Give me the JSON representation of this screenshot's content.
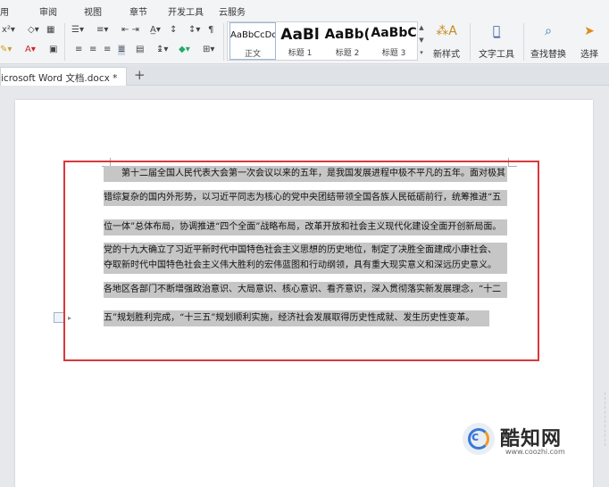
{
  "menu": {
    "items": [
      "用",
      "审阅",
      "视图",
      "章节",
      "开发工具",
      "云服务"
    ]
  },
  "ribbon": {
    "styles": [
      {
        "sample": "AaBbCcDd",
        "caption": "正文"
      },
      {
        "sample": "AaBl",
        "caption": "标题 1"
      },
      {
        "sample": "AaBb(",
        "caption": "标题 2"
      },
      {
        "sample": "AaBbC",
        "caption": "标题 3"
      }
    ],
    "new_style_label": "新样式",
    "text_tools_label": "文字工具",
    "find_replace_label": "查找替换",
    "select_label": "选择",
    "accent_color": "#1f5fbf"
  },
  "tabs": {
    "doc_title": "icrosoft Word 文档.docx *",
    "new_tab_symbol": "+"
  },
  "document": {
    "lines": [
      "　　第十二届全国人民代表大会第一次会议以来的五年，是我国发展进程中极不平凡的五年。面对极其",
      "错综复杂的国内外形势，以习近平同志为核心的党中央团结带领全国各族人民砥砺前行，统筹推进“五",
      "位一体”总体布局，协调推进“四个全面”战略布局，改革开放和社会主义现代化建设全面开创新局面。",
      "党的十九大确立了习近平新时代中国特色社会主义思想的历史地位，制定了决胜全面建成小康社会、",
      "夺取新时代中国特色社会主义伟大胜利的宏伟蓝图和行动纲领，具有重大现实意义和深远历史意义。",
      "各地区各部门不断增强政治意识、大局意识、核心意识、看齐意识，深入贯彻落实新发展理念，“十二",
      "五”规划胜利完成，“十三五”规划顺利实施，经济社会发展取得历史性成就、发生历史性变革。"
    ],
    "selection_color": "#c6c6c6",
    "annotation_color": "#d9383b"
  },
  "watermark": {
    "name": "酷知网",
    "url": "www.coozhi.com"
  }
}
